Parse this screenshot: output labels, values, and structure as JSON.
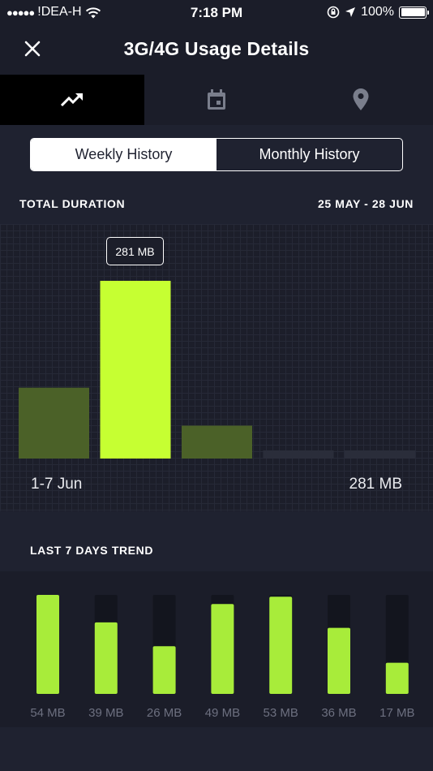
{
  "status_bar": {
    "signal_dots": "●●●●●",
    "carrier": "!DEA-H",
    "time": "7:18 PM",
    "battery": "100%"
  },
  "nav": {
    "title": "3G/4G Usage Details"
  },
  "tabs": [
    {
      "icon": "trending-up-icon",
      "active": true
    },
    {
      "icon": "calendar-icon",
      "active": false
    },
    {
      "icon": "location-pin-icon",
      "active": false
    }
  ],
  "segmented": {
    "weekly": "Weekly History",
    "monthly": "Monthly History"
  },
  "summary": {
    "heading": "TOTAL DURATION",
    "date_range": "25 MAY - 28 JUN",
    "selected_range": "1-7 Jun",
    "selected_total": "281 MB",
    "tooltip": "281 MB"
  },
  "colors": {
    "accent": "#c6ff32",
    "muted_bar": "#4b6128",
    "empty_bar": "#2a2d3a",
    "trend_bar": "#a8ec3a",
    "trend_track": "#13151e"
  },
  "chart_data": [
    {
      "type": "bar",
      "title": "",
      "categories": [
        "",
        "1-7 Jun",
        "",
        "",
        ""
      ],
      "values": [
        112,
        281,
        52,
        0,
        0
      ],
      "selected_index": 1,
      "ylim": [
        0,
        281
      ]
    },
    {
      "type": "bar",
      "title": "LAST 7 DAYS TREND",
      "categories": [
        "54 MB",
        "39 MB",
        "26 MB",
        "49 MB",
        "53 MB",
        "36 MB",
        "17 MB"
      ],
      "values": [
        54,
        39,
        26,
        49,
        53,
        36,
        17
      ],
      "ylim": [
        0,
        54
      ]
    }
  ]
}
